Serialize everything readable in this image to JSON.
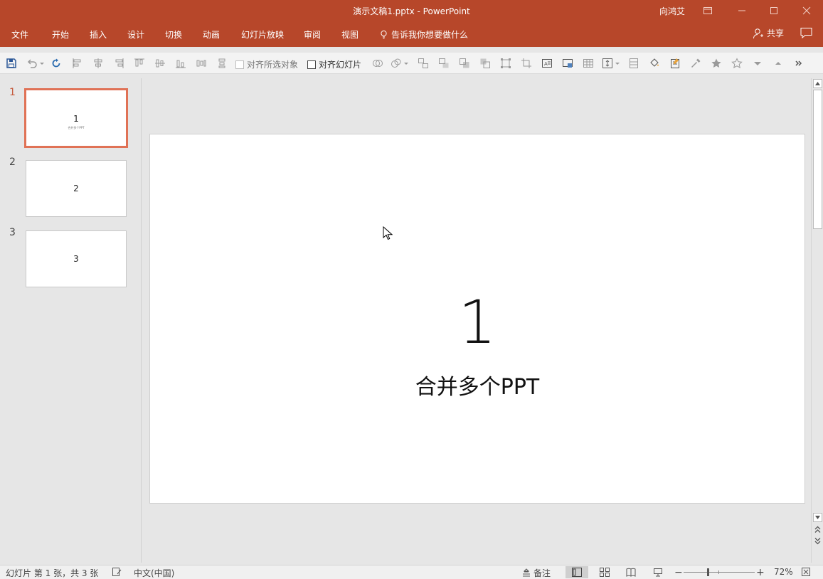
{
  "window": {
    "title": "演示文稿1.pptx  -  PowerPoint",
    "user": "向鸿艾"
  },
  "ribbon": {
    "tabs": [
      "文件",
      "开始",
      "插入",
      "设计",
      "切换",
      "动画",
      "幻灯片放映",
      "审阅",
      "视图"
    ],
    "tell_me": "告诉我你想要做什么",
    "share": "共享"
  },
  "toolbar": {
    "align_selected_label": "对齐所选对象",
    "align_slide_label": "对齐幻灯片"
  },
  "thumbnails": [
    {
      "number": "1",
      "title": "1",
      "subtitle": "合并多个PPT",
      "selected": true
    },
    {
      "number": "2",
      "title": "2",
      "subtitle": "",
      "selected": false
    },
    {
      "number": "3",
      "title": "3",
      "subtitle": "",
      "selected": false
    }
  ],
  "slide": {
    "title": "1",
    "subtitle": "合并多个PPT"
  },
  "status": {
    "slide_info": "幻灯片 第 1 张，共 3 张",
    "language": "中文(中国)",
    "notes": "备注",
    "zoom": "72%",
    "zoom_percent": 72
  },
  "colors": {
    "accent": "#b7472a",
    "thumb_selected": "#e07256"
  }
}
